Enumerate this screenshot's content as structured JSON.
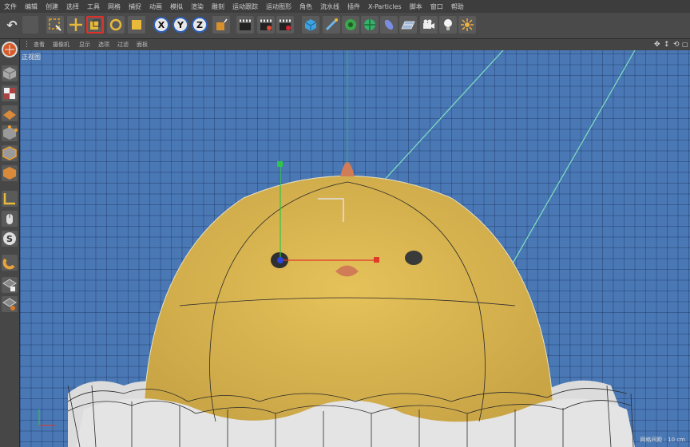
{
  "menu": [
    "文件",
    "编辑",
    "创建",
    "选择",
    "工具",
    "网格",
    "捕捉",
    "动画",
    "模拟",
    "渲染",
    "雕刻",
    "运动跟踪",
    "运动图形",
    "角色",
    "流水线",
    "插件",
    "X-Particles",
    "脚本",
    "窗口",
    "帮助"
  ],
  "toolbar": {
    "undo_icon": "undo-icon",
    "axis_x": "X",
    "axis_y": "Y",
    "axis_z": "Z",
    "scale_active": true
  },
  "viewport_menu": [
    "查看",
    "摄像机",
    "显示",
    "选项",
    "过滤",
    "面板"
  ],
  "viewport": {
    "label": "正视图",
    "grid_spacing": "网格间距 : 10 cm"
  },
  "colors": {
    "viewport_bg": "#4a78b5",
    "chick_body": "#d9b54c",
    "beak": "#d07c56",
    "axis_x_handle": "#e03a2a",
    "axis_y_handle": "#2fc44a",
    "guide_line": "#7fe0c0"
  }
}
